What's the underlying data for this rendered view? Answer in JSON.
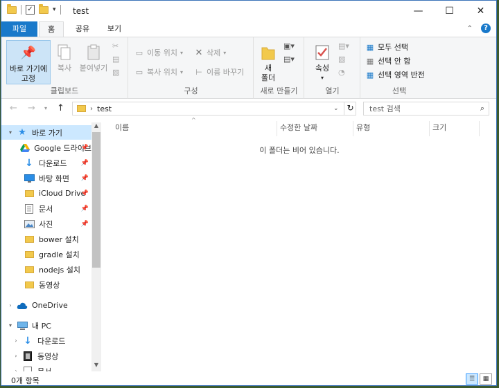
{
  "window": {
    "title": "test",
    "controls": {
      "minimize": "—",
      "maximize": "☐",
      "close": "✕"
    }
  },
  "ribbon_tabs": {
    "file": "파일",
    "home": "홈",
    "share": "공유",
    "view": "보기"
  },
  "ribbon": {
    "clipboard": {
      "label": "클립보드",
      "pin": "바로 가기에\n고정",
      "copy": "복사",
      "paste": "붙여넣기"
    },
    "organize": {
      "label": "구성",
      "move_to": "이동 위치",
      "copy_to": "복사 위치",
      "delete": "삭제",
      "rename": "이름 바꾸기"
    },
    "new": {
      "label": "새로 만들기",
      "new_folder": "새\n폴더"
    },
    "open": {
      "label": "열기",
      "properties": "속성"
    },
    "select": {
      "label": "선택",
      "select_all": "모두 선택",
      "select_none": "선택 안 함",
      "invert": "선택 영역 반전"
    }
  },
  "address": {
    "path_segment": "test",
    "search_placeholder": "test 검색"
  },
  "nav": {
    "quick_access": "바로 가기",
    "items": [
      {
        "label": "Google 드라이브",
        "icon": "google-drive-icon",
        "pinned": true
      },
      {
        "label": "다운로드",
        "icon": "download-icon",
        "pinned": true
      },
      {
        "label": "바탕 화면",
        "icon": "desktop-icon",
        "pinned": true
      },
      {
        "label": "iCloud Drive",
        "icon": "folder-icon",
        "pinned": true
      },
      {
        "label": "문서",
        "icon": "document-icon",
        "pinned": true
      },
      {
        "label": "사진",
        "icon": "pictures-icon",
        "pinned": true
      },
      {
        "label": "bower 설치",
        "icon": "folder-icon",
        "pinned": false
      },
      {
        "label": "gradle 설치",
        "icon": "folder-icon",
        "pinned": false
      },
      {
        "label": "nodejs 설치",
        "icon": "folder-icon",
        "pinned": false
      },
      {
        "label": "동영상",
        "icon": "folder-icon",
        "pinned": false
      }
    ],
    "onedrive": "OneDrive",
    "this_pc": "내 PC",
    "pc_items": [
      {
        "label": "다운로드",
        "icon": "download-icon"
      },
      {
        "label": "동영상",
        "icon": "video-icon"
      },
      {
        "label": "문서",
        "icon": "document-icon"
      }
    ]
  },
  "columns": {
    "name": "이름",
    "modified": "수정한 날짜",
    "type": "유형",
    "size": "크기"
  },
  "empty_message": "이 폴더는 비어 있습니다.",
  "status": {
    "count": "0개 항목"
  },
  "colors": {
    "accent": "#1979ca",
    "selection": "#cce8ff",
    "folder": "#f2c94c"
  }
}
